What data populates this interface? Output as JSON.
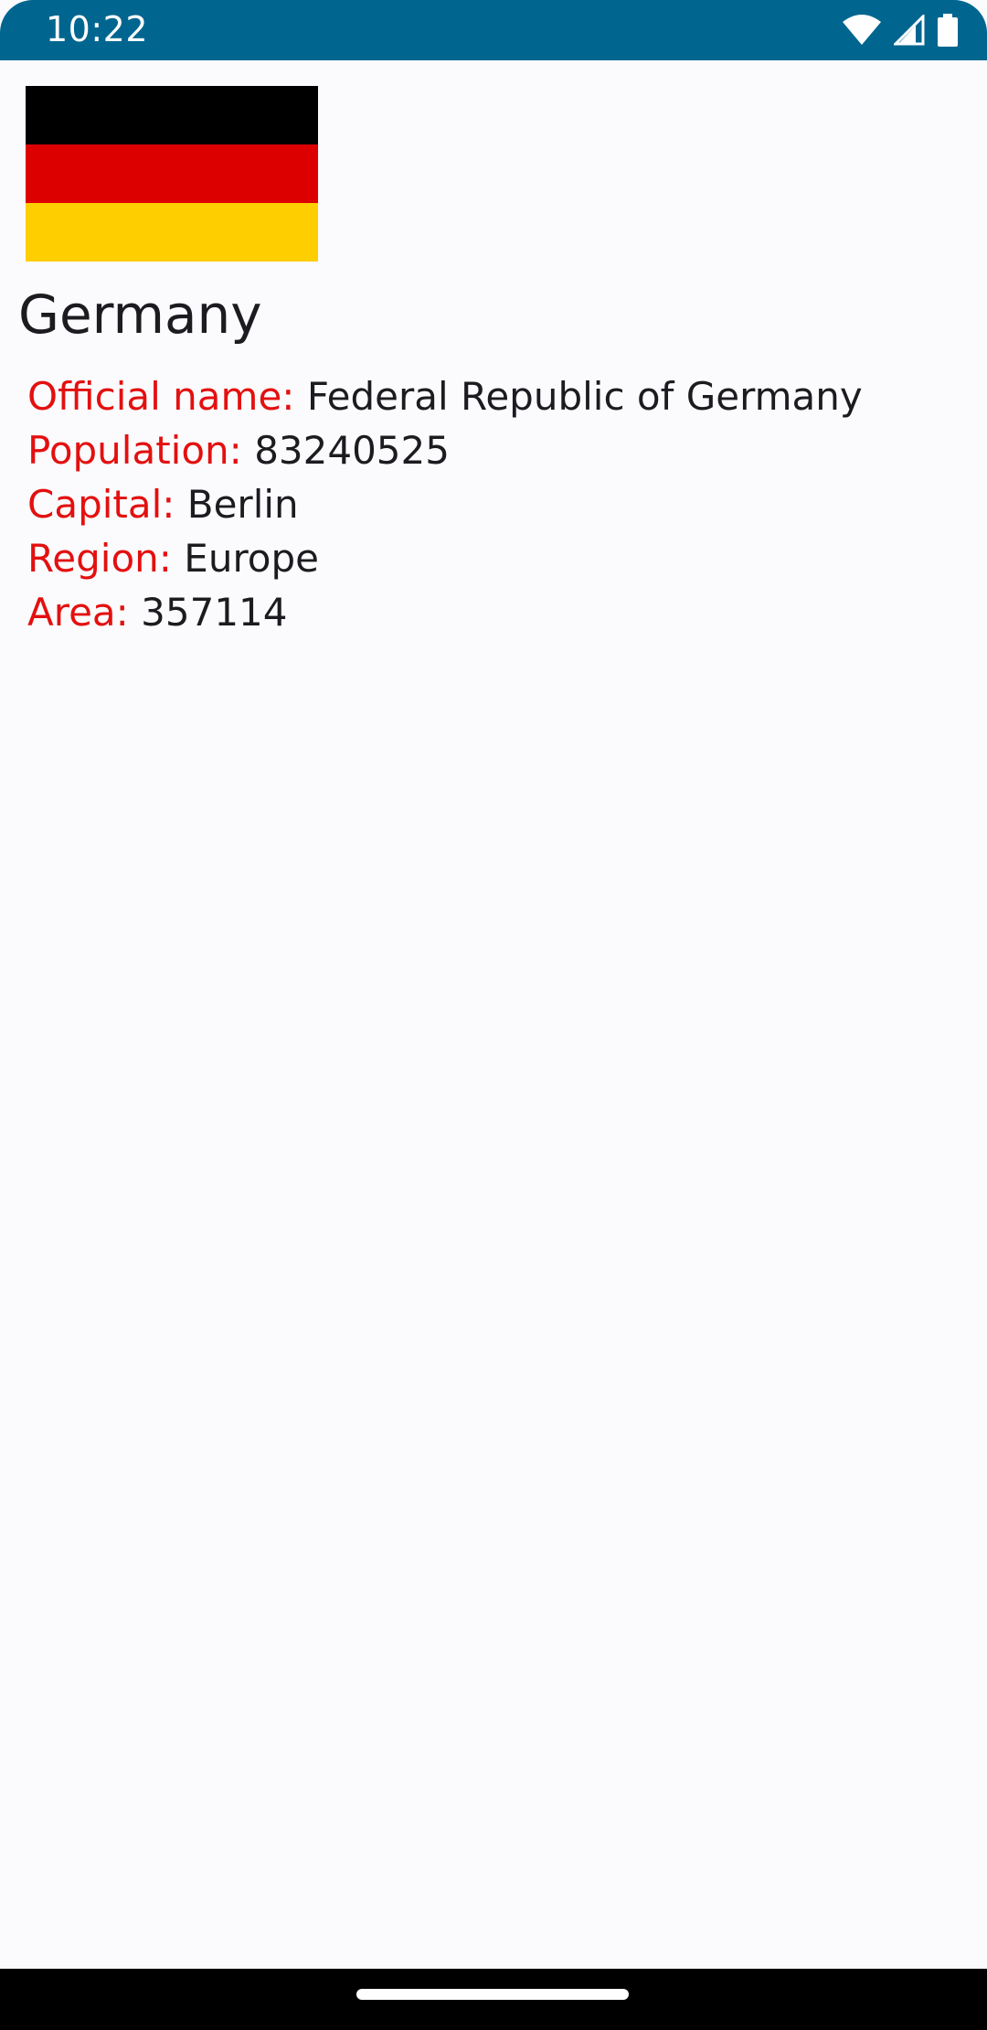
{
  "status_bar": {
    "time": "10:22",
    "icons": [
      "wifi-icon",
      "cellular-signal-icon",
      "battery-icon"
    ],
    "background_color": "#006690"
  },
  "country": {
    "name": "Germany",
    "flag_colors": [
      "#000000",
      "#DD0000",
      "#FFCE00"
    ]
  },
  "details": [
    {
      "label": "Official name:",
      "value": "Federal Republic of Germany"
    },
    {
      "label": "Population:",
      "value": "83240525"
    },
    {
      "label": "Capital:",
      "value": "Berlin"
    },
    {
      "label": "Region:",
      "value": "Europe"
    },
    {
      "label": "Area:",
      "value": "357114"
    }
  ],
  "colors": {
    "label": "#e3100f",
    "value": "#1c1b1f",
    "background": "#fbfbfe"
  }
}
